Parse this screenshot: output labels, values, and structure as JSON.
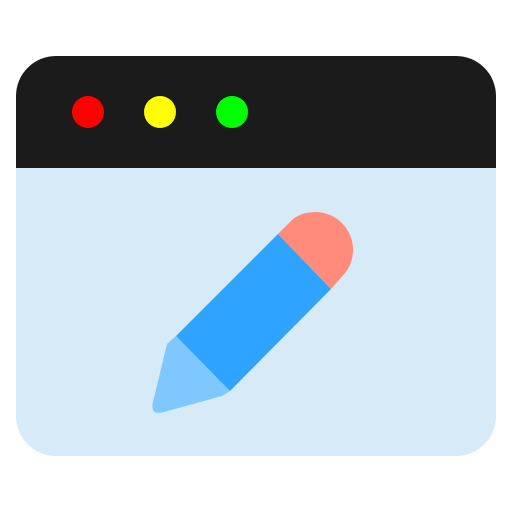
{
  "icon": {
    "name": "edit-window-icon",
    "window": {
      "titlebar_color": "#1b1b1b",
      "body_color": "#d6eaf7",
      "buttons": [
        {
          "name": "close-dot",
          "color": "#ff0000"
        },
        {
          "name": "minimize-dot",
          "color": "#ffff00"
        },
        {
          "name": "maximize-dot",
          "color": "#00ff00"
        }
      ]
    },
    "pencil": {
      "name": "pencil-icon",
      "eraser_color": "#ff8c7a",
      "body_color": "#2ea3ff",
      "tip_color": "#7ec8ff"
    }
  }
}
